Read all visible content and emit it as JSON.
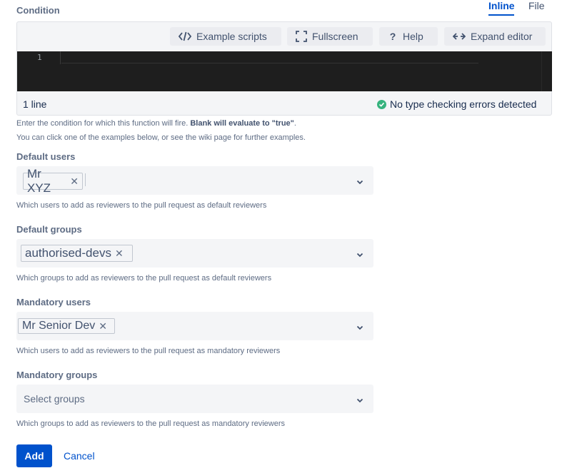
{
  "condition": {
    "label": "Condition",
    "tabs": [
      {
        "label": "Inline",
        "active": true
      },
      {
        "label": "File",
        "active": false
      }
    ],
    "toolbar": {
      "example_scripts": {
        "label": "Example scripts",
        "icon": "code-icon"
      },
      "fullscreen": {
        "label": "Fullscreen",
        "icon": "fullscreen-icon"
      },
      "help": {
        "label": "Help",
        "icon": "question-icon"
      },
      "expand_editor": {
        "label": "Expand editor",
        "icon": "expand-arrows-icon"
      }
    },
    "editor": {
      "line_number": "1",
      "code": ""
    },
    "status": {
      "lines": "1 line",
      "check": "No type checking errors detected",
      "check_color": "#36b37e"
    },
    "help_line1_prefix": "Enter the condition for which this function will fire. ",
    "help_line1_bold": "Blank will evaluate to \"true\"",
    "help_line1_suffix": ".",
    "help_line2": "You can click one of the examples below, or see the wiki page for further examples."
  },
  "default_users": {
    "label": "Default users",
    "selected": [
      "Mr XYZ"
    ],
    "help": "Which users to add as reviewers to the pull request as default reviewers"
  },
  "default_groups": {
    "label": "Default groups",
    "selected": [
      "authorised-devs"
    ],
    "help": "Which groups to add as reviewers to the pull request as default reviewers"
  },
  "mandatory_users": {
    "label": "Mandatory users",
    "selected": [
      "Mr Senior Dev"
    ],
    "help": "Which users to add as reviewers to the pull request as mandatory reviewers"
  },
  "mandatory_groups": {
    "label": "Mandatory groups",
    "placeholder": "Select groups",
    "help": "Which groups to add as reviewers to the pull request as mandatory reviewers"
  },
  "actions": {
    "add": "Add",
    "cancel": "Cancel",
    "primary_color": "#0052cc"
  }
}
